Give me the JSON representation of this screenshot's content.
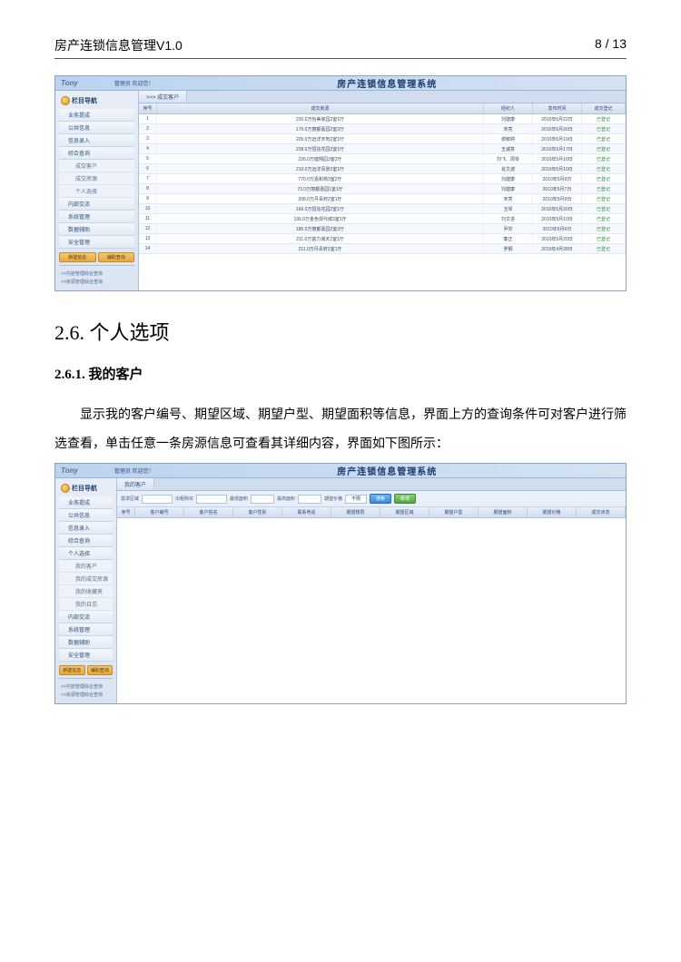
{
  "doc": {
    "title": "房产连锁信息管理V1.0",
    "page": "8 / 13"
  },
  "section": {
    "h1": "2.6. 个人选项",
    "h2": "2.6.1. 我的客户",
    "para": "显示我的客户编号、期望区域、期望户型、期望面积等信息，界面上方的查询条件可对客户进行筛选查看，单击任意一条房源信息可查看其详细内容，界面如下图所示："
  },
  "app": {
    "logo": "Tony",
    "welcome": "管理员 欢迎您！",
    "title": "房产连锁信息管理系统",
    "sidebar_header": "栏目导航"
  },
  "shot1": {
    "tab": ">>> 成交客户",
    "nav": [
      "业务提成",
      "公共信息",
      "信息录入",
      "综合查询"
    ],
    "nav_sub": [
      "成交客户",
      "成交房源",
      "个人选择"
    ],
    "nav_after": [
      "内部交流",
      "系统管理",
      "数据辅助",
      "安全管理"
    ],
    "side_btn1": "新建信息",
    "side_btn2": "辅助查询",
    "side_note1": ">>内容管理综合查询",
    "side_note2": ">>房源管理综合查询",
    "columns": [
      "序号",
      "成交房源",
      "经纪人",
      "发布时间",
      "成交登记"
    ],
    "rows": [
      {
        "n": "1",
        "house": "220.0万怡美家园2室1厅",
        "agent": "刘建康",
        "date": "2010年6月22日",
        "status": "已登记"
      },
      {
        "n": "2",
        "house": "170.0万丽都嘉园2室2厅",
        "agent": "宋亮",
        "date": "2010年6月20日",
        "status": "已登记"
      },
      {
        "n": "3",
        "house": "205.0万远洋天地2室1厅",
        "agent": "谢敏婷",
        "date": "2010年6月19日",
        "status": "已登记"
      },
      {
        "n": "4",
        "house": "228.0万恒信花园2室1厅",
        "agent": "玉诚意",
        "date": "2010年6月17日",
        "status": "已登记"
      },
      {
        "n": "5",
        "house": "226.0万健翔园3室2厅",
        "agent": "刘飞、周琴",
        "date": "2010年5月10日",
        "status": "已登记"
      },
      {
        "n": "6",
        "house": "210.0万远洋风景2室1厅",
        "agent": "肖文波",
        "date": "2010年5月10日",
        "status": "已登记"
      },
      {
        "n": "7",
        "house": "770.0万嘉和苑3室2厅",
        "agent": "刘建康",
        "date": "2010年5月9日",
        "status": "已登记"
      },
      {
        "n": "8",
        "house": "73.0万丽都嘉园1室1厅",
        "agent": "刘建康",
        "date": "2010年5月7日",
        "status": "已登记"
      },
      {
        "n": "9",
        "house": "208.0万丹青府2室1厅",
        "agent": "宋亮",
        "date": "2010年5月9日",
        "status": "已登记"
      },
      {
        "n": "10",
        "house": "160.0万恒信花园2室1厅",
        "agent": "玉琴",
        "date": "2010年5月20日",
        "status": "已登记"
      },
      {
        "n": "11",
        "house": "195.0万金色现代城3室1厅",
        "agent": "刘文进",
        "date": "2010年5月10日",
        "status": "已登记"
      },
      {
        "n": "12",
        "house": "180.0万丽都嘉园2室2厅",
        "agent": "尹莎",
        "date": "2010年6月9日",
        "status": "已登记"
      },
      {
        "n": "13",
        "house": "211.0万富力城天2室1厅",
        "agent": "秦正",
        "date": "2010年5月20日",
        "status": "已登记"
      },
      {
        "n": "14",
        "house": "211.0万丹青府2室1厅",
        "agent": "罗钢",
        "date": "2010年4月28日",
        "status": "已登记"
      }
    ]
  },
  "shot2": {
    "tab": "我的客户",
    "nav": [
      "业务提成",
      "公共信息",
      "信息录入",
      "综合查询",
      "个人选择"
    ],
    "nav_sub": [
      "我的客户",
      "我的成交房源",
      "我的收藏夹",
      "我的日志"
    ],
    "nav_after": [
      "内部交流",
      "系统管理",
      "数据辅助",
      "安全管理"
    ],
    "side_btn1": "新建信息",
    "side_btn2": "辅助查询",
    "side_note1": ">>内容管理综合查询",
    "side_note2": ">>房源管理综合查询",
    "filter_labels": {
      "area": "需求区域",
      "way": "出租购买",
      "min": "最低面积",
      "max": "最高面积",
      "price": "期望价格",
      "unit": "不限"
    },
    "search_btn": "搜索",
    "add_btn": "新增",
    "columns": [
      "序号",
      "客户编号",
      "客户姓名",
      "客户性别",
      "联系电话",
      "期望楼层",
      "期望区域",
      "期望户型",
      "期望面积",
      "期望价格",
      "成交状态"
    ]
  }
}
